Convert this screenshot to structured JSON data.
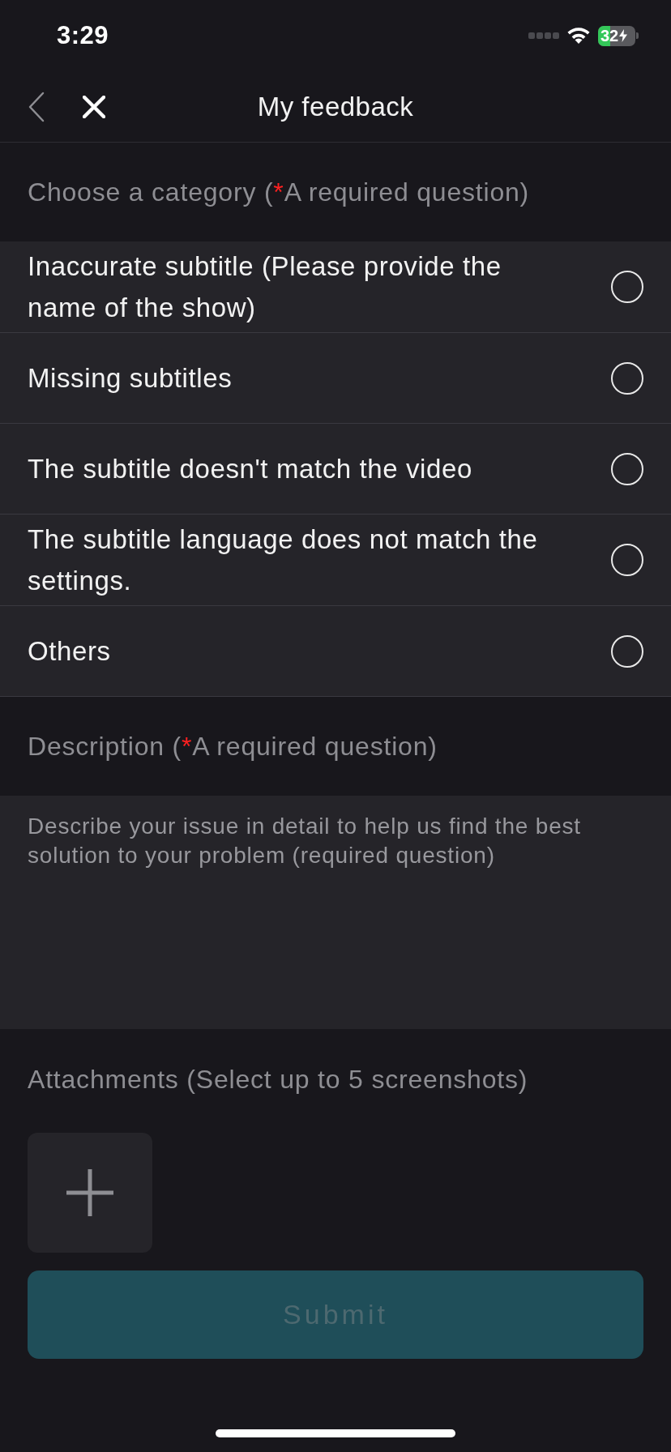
{
  "status_bar": {
    "time": "3:29",
    "battery": "32"
  },
  "header": {
    "title": "My feedback"
  },
  "category": {
    "label": {
      "before": "Choose a category (",
      "mark": "*",
      "after": "A required question)"
    },
    "options": [
      {
        "label": "Inaccurate subtitle (Please provide the name of the show)",
        "selected": false
      },
      {
        "label": "Missing subtitles",
        "selected": false
      },
      {
        "label": "The subtitle doesn't match the video",
        "selected": false
      },
      {
        "label": "The subtitle language does not match the settings.",
        "selected": false
      },
      {
        "label": "Others",
        "selected": false
      }
    ]
  },
  "description": {
    "label": {
      "before": "Description (",
      "mark": "*",
      "after": "A required question)"
    },
    "placeholder": "Describe your issue in detail to help us find the best solution to your problem (required question)"
  },
  "attachments": {
    "label": "Attachments (Select up to 5 screenshots)"
  },
  "submit": {
    "label": "Submit",
    "disabled": true
  }
}
